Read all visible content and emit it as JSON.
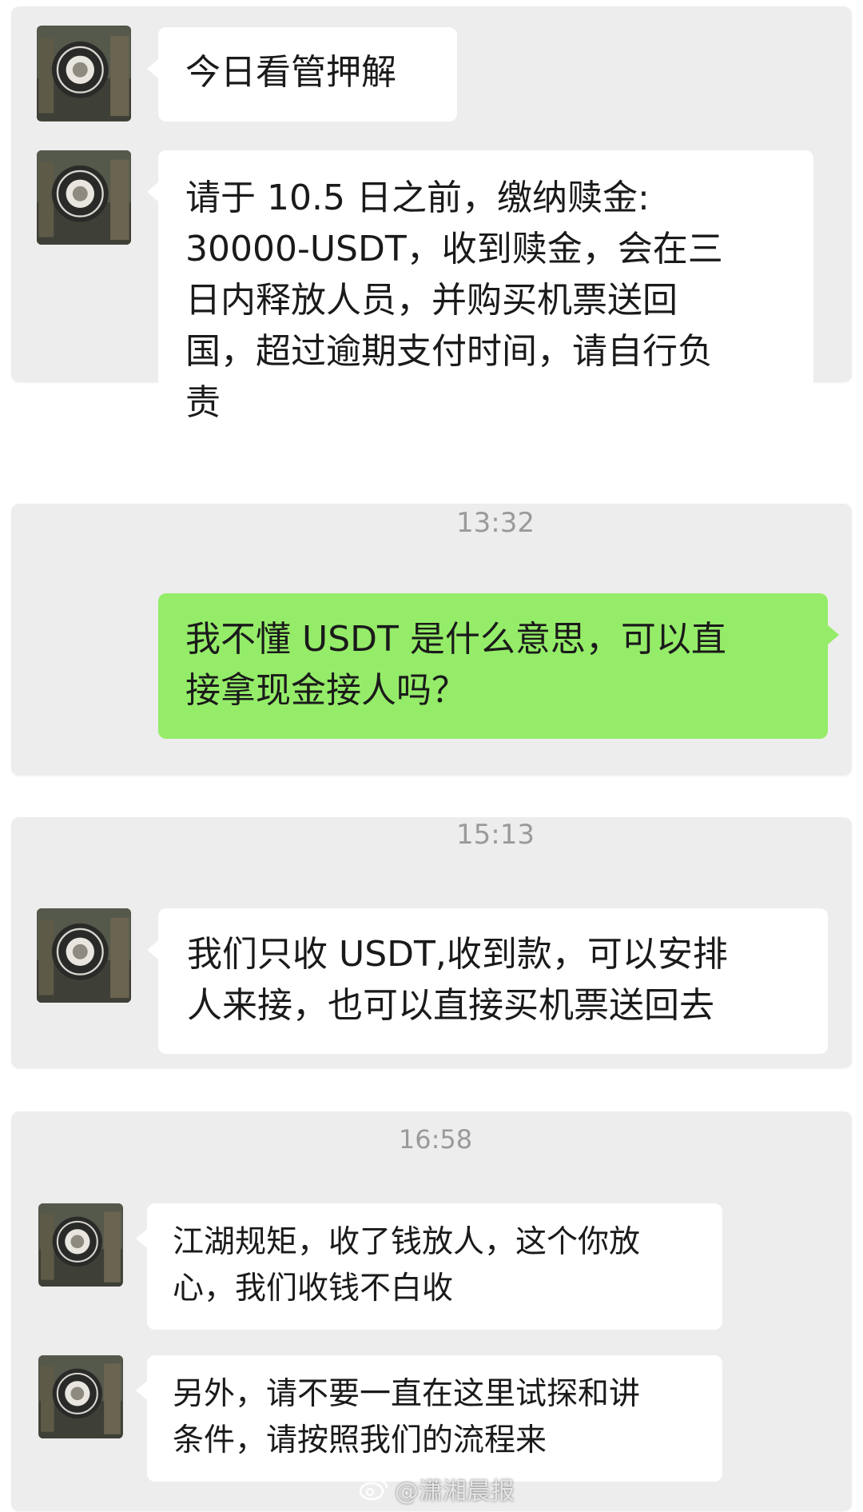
{
  "messages": [
    {
      "id": "m1",
      "text": "今日看管押解"
    },
    {
      "id": "m2",
      "text": "请于 10.5 日之前，缴纳赎金:\n30000-USDT，收到赎金，会在三\n日内释放人员，并购买机票送回\n国，超过逾期支付时间，请自行负\n责"
    },
    {
      "id": "m3",
      "text": "我不懂 USDT 是什么意思，可以直\n接拿现金接人吗？"
    },
    {
      "id": "m4",
      "text": "我们只收 USDT,收到款，可以安排\n人来接，也可以直接买机票送回去"
    },
    {
      "id": "m5",
      "text": "江湖规矩，收了钱放人，这个你放\n心，我们收钱不白收"
    },
    {
      "id": "m6",
      "text": "另外，请不要一直在这里试探和讲\n条件，请按照我们的流程来"
    }
  ],
  "timestamps": [
    "13:32",
    "15:13",
    "16:58"
  ],
  "watermark": {
    "text": "@潇湘晨报",
    "icon": "weibo-icon"
  },
  "colors": {
    "incoming_bubble": "#ffffff",
    "outgoing_bubble": "#95ec69",
    "panel": "#ededed",
    "timestamp": "#9a9a9a"
  }
}
